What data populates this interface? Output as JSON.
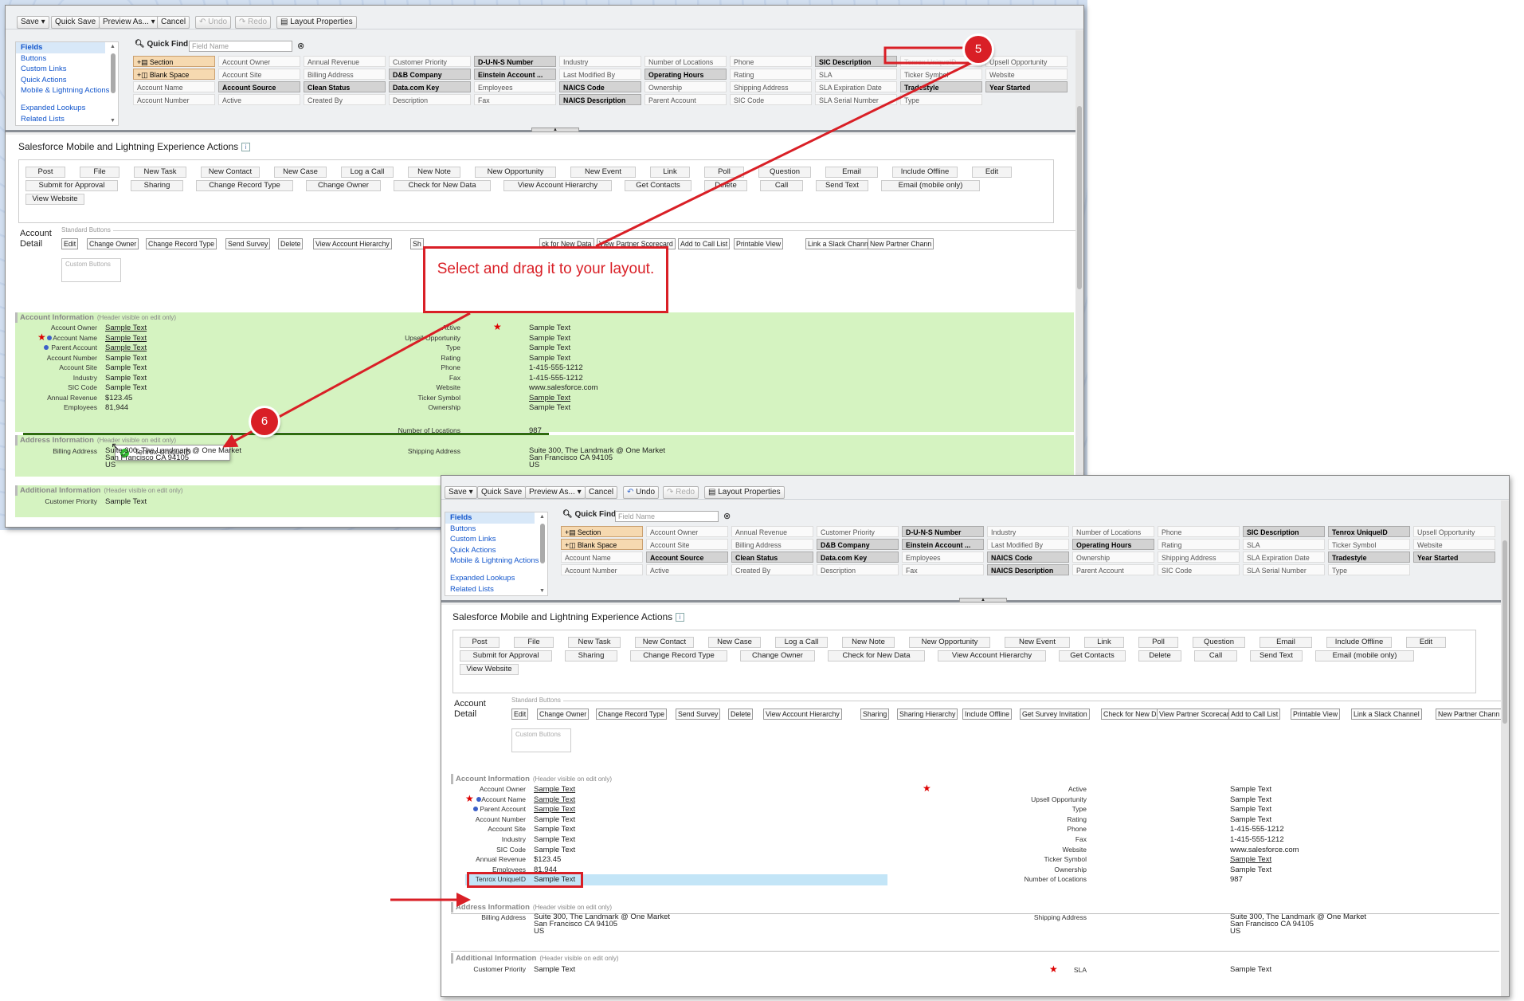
{
  "toolbar": {
    "save": "Save",
    "quick_save": "Quick Save",
    "preview_as": "Preview As...",
    "cancel": "Cancel",
    "undo": "Undo",
    "redo": "Redo",
    "layout_properties": "Layout Properties"
  },
  "palette": {
    "categories": [
      "Fields",
      "Buttons",
      "Custom Links",
      "Quick Actions",
      "Mobile & Lightning Actions",
      "Expanded Lookups",
      "Related Lists"
    ],
    "quick_find_label": "Quick Find",
    "quick_find_placeholder": "Field Name",
    "fields": [
      [
        "Section",
        "Blank Space",
        "Account Name",
        "Account Number"
      ],
      [
        "Account Owner",
        "Account Site",
        "Account Source",
        "Active"
      ],
      [
        "Annual Revenue",
        "Billing Address",
        "Clean Status",
        "Created By"
      ],
      [
        "Customer Priority",
        "D&B Company",
        "Data.com Key",
        "Description"
      ],
      [
        "D-U-N-S Number",
        "Einstein Account ...",
        "Employees",
        "Fax"
      ],
      [
        "Industry",
        "Last Modified By",
        "NAICS Code",
        "NAICS Description"
      ],
      [
        "Number of Locations",
        "Operating Hours",
        "Ownership",
        "Parent Account"
      ],
      [
        "Phone",
        "Rating",
        "Shipping Address",
        "SIC Code"
      ],
      [
        "SIC Description",
        "SLA",
        "SLA Expiration Date",
        "SLA Serial Number"
      ],
      [
        "Tenrox UniqueID",
        "Ticker Symbol",
        "Tradestyle",
        "Type"
      ],
      [
        "Upsell Opportunity",
        "Website",
        "Year Started",
        ""
      ]
    ]
  },
  "actions": {
    "title": "Salesforce Mobile and Lightning Experience Actions",
    "row1": [
      "Post",
      "File",
      "New Task",
      "New Contact",
      "New Case",
      "Log a Call",
      "New Note",
      "New Opportunity",
      "New Event",
      "Link",
      "Poll",
      "Question",
      "Email",
      "Include Offline",
      "Edit"
    ],
    "row2": [
      "Submit for Approval",
      "Sharing",
      "Change Record Type",
      "Change Owner",
      "Check for New Data",
      "View Account Hierarchy",
      "Get Contacts",
      "Delete",
      "Call",
      "Send Text",
      "Email (mobile only)"
    ],
    "row3": [
      "View Website"
    ]
  },
  "account_detail": {
    "label": "Account Detail",
    "standard_buttons_title": "Standard Buttons",
    "custom_buttons_title": "Custom Buttons",
    "standard_buttons": [
      "Edit",
      "Change Owner",
      "Change Record Type",
      "Send Survey",
      "Delete",
      "View Account Hierarchy",
      "Sharing",
      "Sharing Hierarchy",
      "Include Offline",
      "Get Survey Invitation",
      "Check for New Data",
      "View Partner Scorecard",
      "Add to Call List",
      "Printable View",
      "Link a Slack Channel",
      "New Partner Chann"
    ],
    "standard_buttons_partial_1": [
      "Edit",
      "Change Owner",
      "Change Record Type",
      "Send Survey",
      "Delete",
      "View Account Hierarchy",
      "Sh"
    ],
    "standard_buttons_partial_2": [
      "ck for New Data",
      "View Partner Scorecard",
      "Add to Call List",
      "Printable View",
      "Link a Slack Channel",
      "New Partner Chann"
    ]
  },
  "account_info": {
    "title": "Account Information",
    "hint": "(Header visible on edit only)",
    "left_labels": [
      "Account Owner",
      "Account Name",
      "Parent Account",
      "Account Number",
      "Account Site",
      "Industry",
      "SIC Code",
      "Annual Revenue",
      "Employees"
    ],
    "left_values": [
      "Sample Text",
      "Sample Text",
      "Sample Text",
      "Sample Text",
      "Sample Text",
      "Sample Text",
      "Sample Text",
      "$123.45",
      "81,944"
    ],
    "right_labels": [
      "Active",
      "Upsell Opportunity",
      "Type",
      "Rating",
      "Phone",
      "Fax",
      "Website",
      "Ticker Symbol",
      "Ownership",
      "Number of Locations"
    ],
    "right_values": [
      "Sample Text",
      "Sample Text",
      "Sample Text",
      "Sample Text",
      "1-415-555-1212",
      "1-415-555-1212",
      "www.salesforce.com",
      "Sample Text",
      "Sample Text",
      "987"
    ],
    "drag_item": "Tenrox UniqueID",
    "inserted_label": "Tenrox UniqueID",
    "inserted_value": "Sample Text"
  },
  "address_info": {
    "title": "Address Information",
    "hint": "(Header visible on edit only)",
    "billing_label": "Billing Address",
    "billing_lines": [
      "Suite 300, The Landmark @ One Market",
      "San Francisco CA 94105",
      "US"
    ],
    "shipping_label": "Shipping Address",
    "shipping_lines": [
      "Suite 300, The Landmark @ One Market",
      "San Francisco CA 94105",
      "US"
    ]
  },
  "additional_info": {
    "title": "Additional Information",
    "hint": "(Header visible on edit only)",
    "customer_priority_label": "Customer Priority",
    "customer_priority_value": "Sample Text",
    "sla_label": "SLA",
    "sla_value": "Sample Text"
  },
  "annotations": {
    "callout_text": "Select and drag it to your layout.",
    "step5": "5",
    "step6": "6",
    "accent_color": "#d91f26"
  }
}
